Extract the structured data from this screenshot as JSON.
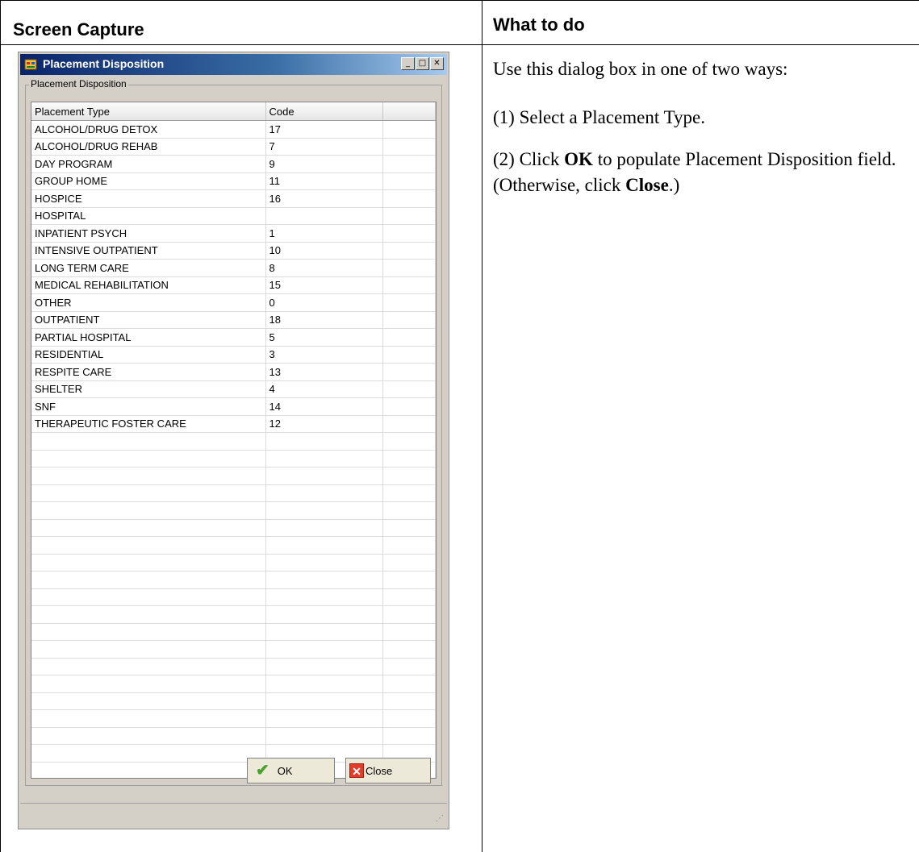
{
  "columns": {
    "left_header": "Screen Capture",
    "right_header": "What to do"
  },
  "dialog": {
    "title": "Placement Disposition",
    "icon": "app-window-icon",
    "group_label": "Placement Disposition",
    "grid": {
      "headers": [
        "Placement Type",
        "Code",
        ""
      ],
      "rows": [
        {
          "type": "ALCOHOL/DRUG DETOX",
          "code": "17"
        },
        {
          "type": "ALCOHOL/DRUG REHAB",
          "code": "7"
        },
        {
          "type": "DAY PROGRAM",
          "code": "9"
        },
        {
          "type": "GROUP HOME",
          "code": "11"
        },
        {
          "type": "HOSPICE",
          "code": "16"
        },
        {
          "type": "HOSPITAL",
          "code": ""
        },
        {
          "type": "INPATIENT PSYCH",
          "code": "1"
        },
        {
          "type": "INTENSIVE OUTPATIENT",
          "code": "10"
        },
        {
          "type": "LONG TERM CARE",
          "code": "8"
        },
        {
          "type": "MEDICAL REHABILITATION",
          "code": "15"
        },
        {
          "type": "OTHER",
          "code": "0"
        },
        {
          "type": "OUTPATIENT",
          "code": "18"
        },
        {
          "type": "PARTIAL HOSPITAL",
          "code": "5"
        },
        {
          "type": "RESIDENTIAL",
          "code": "3"
        },
        {
          "type": "RESPITE CARE",
          "code": "13"
        },
        {
          "type": "SHELTER",
          "code": "4"
        },
        {
          "type": "SNF",
          "code": "14"
        },
        {
          "type": "THERAPEUTIC FOSTER CARE",
          "code": "12"
        }
      ]
    },
    "ok_label": "OK",
    "close_label": "Close"
  },
  "instructions": {
    "intro": "Use this dialog box in one of two ways:",
    "step1": "(1) Select a Placement Type.",
    "step2_prefix": "(2) Click ",
    "step2_ok": "OK",
    "step2_mid": " to populate Placement Disposition field. (Otherwise, click ",
    "step2_close": "Close",
    "step2_suffix": ".)"
  }
}
